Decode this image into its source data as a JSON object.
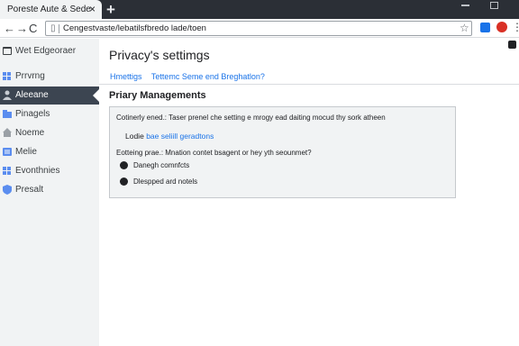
{
  "browser": {
    "tab_title": "Poreste Aute & Sede",
    "tab_close": "×",
    "new_tab": "+",
    "url": "Cengestvaste/lebatilsfbredo lade/toen",
    "nav": {
      "back": "←",
      "forward": "→",
      "reload": "C"
    },
    "menu": "⋮"
  },
  "sidebar": {
    "items": [
      {
        "label": "Wet Edgeoraer",
        "icon": "browser-icon",
        "color": "#3c4043",
        "active": false
      },
      {
        "label": "Prrvrng",
        "icon": "privacy-icon",
        "color": "#5b8def",
        "active": false
      },
      {
        "label": "Aleeane",
        "icon": "person-icon",
        "color": "#c8ccd2",
        "active": true
      },
      {
        "label": "Pinagels",
        "icon": "folder-icon",
        "color": "#5b8def",
        "active": false
      },
      {
        "label": "Noeme",
        "icon": "home-icon",
        "color": "#9aa0a6",
        "active": false
      },
      {
        "label": "Melie",
        "icon": "grid-icon",
        "color": "#5b8def",
        "active": false
      },
      {
        "label": "Evonthnies",
        "icon": "apps-icon",
        "color": "#5b8def",
        "active": false
      },
      {
        "label": "Presalt",
        "icon": "shield-icon",
        "color": "#5b8def",
        "active": false
      }
    ]
  },
  "main": {
    "title": "Privacy's settimgs",
    "crumbs": [
      "Hmettigs",
      "Tettemc Seme end Breghatlon?"
    ],
    "section_title": "Priary Managements",
    "panel": {
      "description": "Cotinerly ened.: Taser prenel che setting e mrogy ead daiting mocud thy sork atheen",
      "link_prefix": "Lodie",
      "link_text": "bae seliill geradtons",
      "note": "Eotteing prae.: Mnation contet bsagent or hey yth seounmet?",
      "options": [
        "Danegh comnfcts",
        "Dlespped ard notels"
      ]
    }
  }
}
